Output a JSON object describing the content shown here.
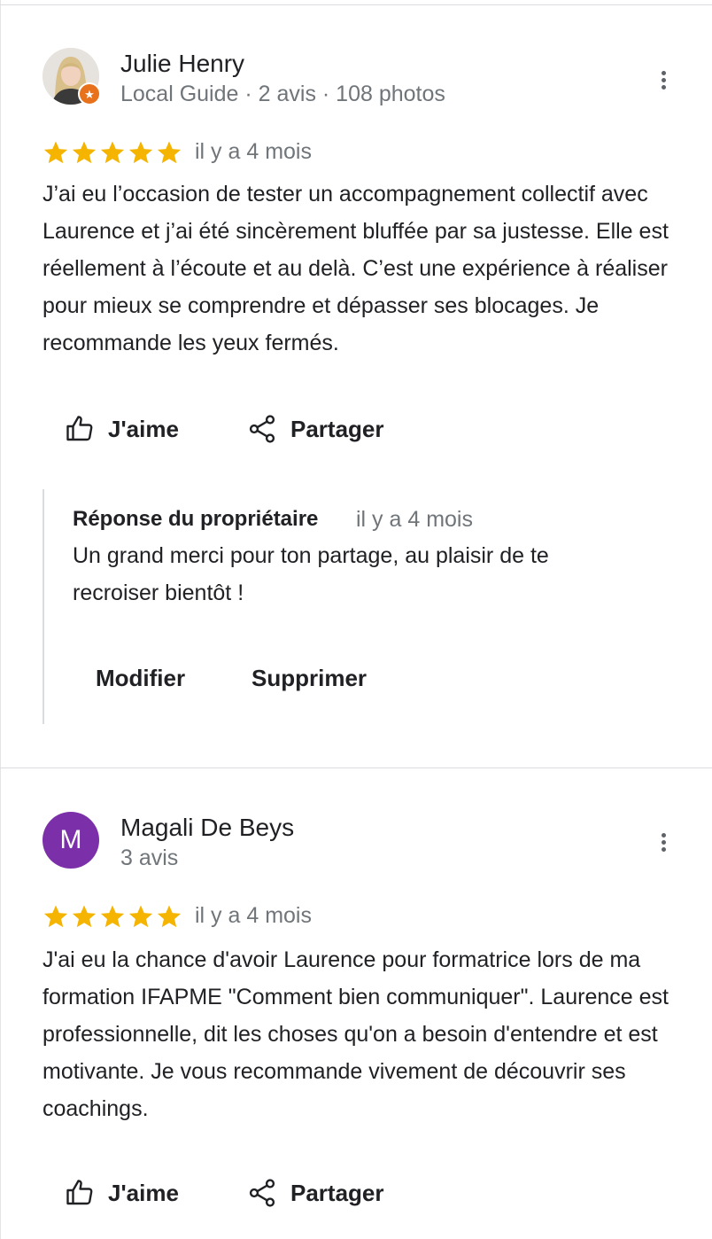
{
  "reviews": [
    {
      "author": "Julie Henry",
      "meta": "Local Guide · 2 avis · 108 photos",
      "rating": 5,
      "time": "il y a 4 mois",
      "text": "J’ai eu l’occasion de tester un accompagnement collectif avec Laurence et j’ai été sincèrement bluffée par sa justesse. Elle est réellement à l’écoute et au delà. C’est une expérience à réaliser pour mieux se comprendre et dépasser ses blocages. Je recommande les yeux fermés.",
      "like_label": "J'aime",
      "share_label": "Partager",
      "owner_reply": {
        "title": "Réponse du propriétaire",
        "time": "il y a 4 mois",
        "text": "Un grand merci pour ton partage, au plaisir de te recroiser bientôt !",
        "edit_label": "Modifier",
        "delete_label": "Supprimer"
      }
    },
    {
      "author": "Magali De Beys",
      "avatar_letter": "M",
      "meta": "3 avis",
      "rating": 5,
      "time": "il y a 4 mois",
      "text": "J'ai eu la chance d'avoir Laurence pour formatrice lors de ma formation IFAPME \"Comment bien communiquer\". Laurence est professionnelle, dit les choses qu'on a besoin d'entendre et est motivante. Je vous recommande vivement de découvrir ses coachings.",
      "like_label": "J'aime",
      "share_label": "Partager"
    }
  ],
  "colors": {
    "star": "#f4b400",
    "avatar_bg": "#7b2fa8",
    "guide_badge": "#e8711b",
    "secondary_text": "#70757a"
  },
  "icons": [
    "more-vert-icon",
    "star-icon",
    "thumb-up-icon",
    "share-icon",
    "local-guide-badge-icon"
  ]
}
